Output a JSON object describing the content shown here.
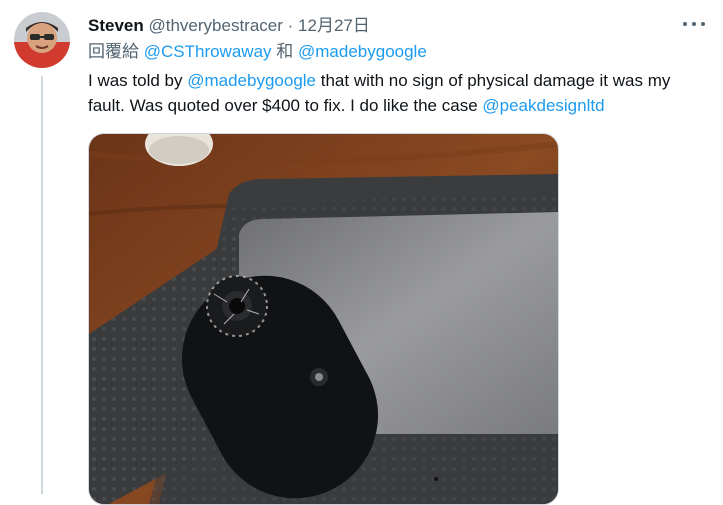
{
  "tweet": {
    "author_name": "Steven",
    "author_handle": "@thverybestracer",
    "separator": "·",
    "timestamp": "12月27日",
    "reply_prefix": "回覆給",
    "reply_mention_1": "@CSThrowaway",
    "reply_joiner": "和",
    "reply_mention_2": "@madebygoogle",
    "text_part_1": "I was told by ",
    "text_mention_1": "@madebygoogle",
    "text_part_2": " that with no sign of physical damage it was my fault. Was quoted over $400 to fix. I do like the case ",
    "text_mention_2": "@peakdesignltd"
  },
  "icons": {
    "more": "more-horizontal-icon"
  },
  "colors": {
    "link": "#1d9bf0",
    "secondary_text": "#536471",
    "primary_text": "#0f1419",
    "thread_line": "#cfd9de"
  }
}
